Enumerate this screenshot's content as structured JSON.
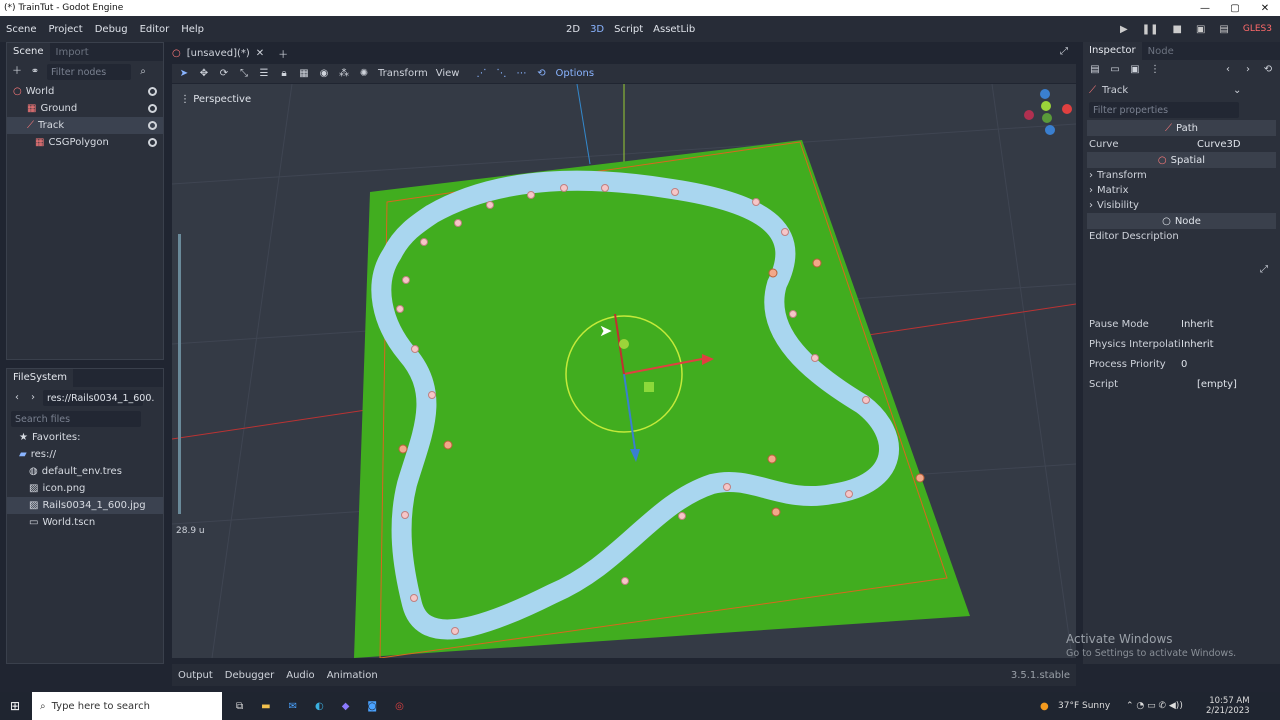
{
  "window": {
    "title": "(*) TrainTut - Godot Engine"
  },
  "menubar": {
    "items": [
      "Scene",
      "Project",
      "Debug",
      "Editor",
      "Help"
    ],
    "modes": [
      "2D",
      "3D",
      "Script",
      "AssetLib"
    ],
    "renderer": "GLES3"
  },
  "scene_panel": {
    "tabs": [
      "Scene",
      "Import"
    ],
    "filter_placeholder": "Filter nodes",
    "nodes": [
      "World",
      "Ground",
      "Track",
      "CSGPolygon"
    ]
  },
  "filesystem": {
    "title": "FileSystem",
    "path": "res://Rails0034_1_600.",
    "search_placeholder": "Search files",
    "favorites": "Favorites:",
    "root": "res://",
    "files": [
      "default_env.tres",
      "icon.png",
      "Rails0034_1_600.jpg",
      "World.tscn"
    ]
  },
  "editor": {
    "tab": "[unsaved](*)",
    "menus": [
      "Transform",
      "View"
    ],
    "options": "Options",
    "perspective": "Perspective",
    "zoom": "28.9 u"
  },
  "inspector": {
    "tabs": [
      "Inspector",
      "Node"
    ],
    "node": "Track",
    "filter_placeholder": "Filter properties",
    "sections": [
      "Path",
      "Spatial",
      "Node"
    ],
    "curve_label": "Curve",
    "curve_value": "Curve3D",
    "groups": [
      "Transform",
      "Matrix",
      "Visibility"
    ],
    "editor_description": "Editor Description",
    "props": [
      {
        "label": "Pause Mode",
        "value": "Inherit"
      },
      {
        "label": "Physics Interpolati",
        "value": "Inherit"
      },
      {
        "label": "Process Priority",
        "value": "0"
      },
      {
        "label": "Script",
        "value": "[empty]"
      }
    ]
  },
  "bottom": {
    "tabs": [
      "Output",
      "Debugger",
      "Audio",
      "Animation"
    ],
    "version": "3.5.1.stable"
  },
  "watermark": {
    "line1": "Activate Windows",
    "line2": "Go to Settings to activate Windows."
  },
  "taskbar": {
    "search": "Type here to search",
    "weather": "37°F  Sunny",
    "time": "10:57 AM",
    "date": "2/21/2023"
  },
  "colors": {
    "ground": "#41ad1f",
    "track": "#a9d6ef",
    "accent": "#8ab4ff"
  }
}
